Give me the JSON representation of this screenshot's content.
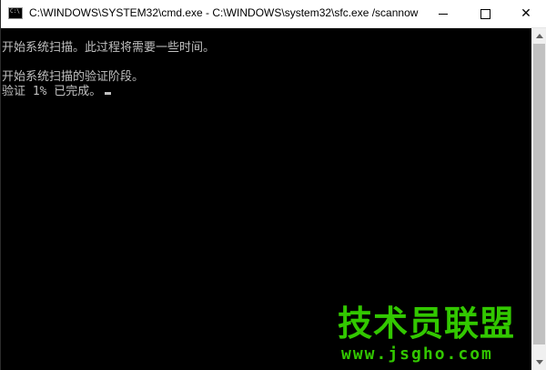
{
  "window": {
    "title": "C:\\WINDOWS\\SYSTEM32\\cmd.exe - C:\\WINDOWS\\system32\\sfc.exe  /scannow",
    "icon_label": "C:\\",
    "icon": "cmd-icon"
  },
  "controls": {
    "minimize_icon": "minimize-icon",
    "maximize_icon": "maximize-icon",
    "close_glyph": "✕"
  },
  "console": {
    "lines": [
      "开始系统扫描。此过程将需要一些时间。",
      "开始系统扫描的验证阶段。",
      "验证 1% 已完成。"
    ],
    "text_color": "#c0c0c0",
    "background": "#000000"
  },
  "watermark": {
    "logo": "技术员联盟",
    "url": "www.jsgho.com",
    "color": "#32c800"
  }
}
